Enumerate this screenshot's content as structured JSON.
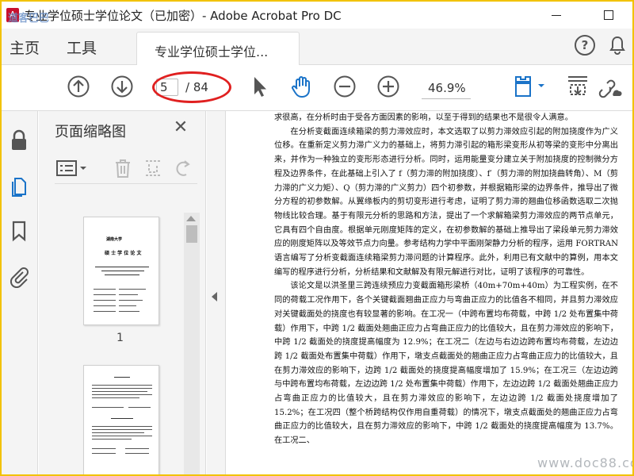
{
  "window": {
    "title": "专业学位硕士学位论文（已加密）- Adobe Acrobat Pro DC"
  },
  "tabs": {
    "home": "主页",
    "tools": "工具",
    "document": "专业学位硕士学位..."
  },
  "toolbar": {
    "page_current": "5",
    "page_total": "/ 84",
    "zoom": "46.9%",
    "icons": [
      "prev-page-icon",
      "next-page-icon",
      "select-arrow-icon",
      "hand-icon",
      "zoom-out-icon",
      "zoom-in-icon",
      "page-layout-icon",
      "scroll-mode-icon",
      "link-icon"
    ]
  },
  "sidebar": {
    "panel_title": "页面缩略图",
    "thumbnails": [
      {
        "label": "1",
        "university": "湖南大学",
        "heading": "硕 士 学 位 论 文"
      },
      {
        "label": ""
      }
    ]
  },
  "document": {
    "paragraphs": [
      {
        "indent": false,
        "text": "求很高，在分析时由于受各方面因素的影响，以至于得到的结果也不是很令人满意。"
      },
      {
        "indent": true,
        "text": "在分析变截面连续箱梁的剪力滞效应时，本文选取了以剪力滞效应引起的附加挠度作为广义位移。在重新定义剪力滞广义力的基础上，将剪力滞引起的箱形梁变形从初等梁的变形中分离出来，并作为一种独立的变形形态进行分析。同时，运用能量变分建立关于附加挠度的控制微分方程及边界条件，在此基础上引入了 f（剪力滞的附加挠度）、f′（剪力滞的附加挠曲转角）、M（剪力滞的广义力矩）、Q（剪力滞的广义剪力）四个初参数，并根据箱形梁的边界条件，推导出了微分方程的初参数解。从翼缘板内的剪切变形进行考虑，证明了剪力滞的翘曲位移函数选取二次抛物线比较合理。基于有限元分析的思路和方法，提出了一个求解箱梁剪力滞效应的两节点单元，它具有四个自由度。根据单元刚度矩阵的定义，在初参数解的基础上推导出了梁段单元剪力滞效应的刚度矩阵以及等效节点力向量。参考结构力学中平面刚架静力分析的程序，运用 FORTRAN 语言编写了分析变截面连续箱梁剪力滞问题的计算程序。此外，利用已有文献中的算例，用本文编写的程序进行分析，分析结果和文献解及有限元解进行对比，证明了该程序的可靠性。"
      },
      {
        "indent": true,
        "text": "该论文是以洪圣里三跨连续预应力变截面箱形梁桥（40m+70m+40m）为工程实例，在不同的荷载工况作用下，各个关键截面翘曲正应力与弯曲正应力的比值各不相同，并且剪力滞效应对关键截面处的挠度也有较显著的影响。在工况一（中跨布置均布荷载，中跨 1/2 处布置集中荷载）作用下，中跨 1/2 截面处翘曲正应力占弯曲正应力的比值较大，且在剪力滞效应的影响下，中跨 1/2 截面处的挠度提高幅度为 12.9%；在工况二（左边与右边边跨布置均布荷载，左边边跨 1/2 截面处布置集中荷载）作用下，墩支点截面处的翘曲正应力占弯曲正应力的比值较大，且在剪力滞效应的影响下，边跨 1/2 截面处的挠度提高幅度增加了 15.9%；在工况三（左边边跨与中跨布置均布荷载，左边边跨 1/2 处布置集中荷载）作用下，左边边跨 1/2 截面处翘曲正应力占弯曲正应力的比值较大，且在剪力滞效应的影响下，左边边跨 1/2 截面处挠度增加了 15.2%；在工况四（整个桥跨结构仅作用自重荷载）的情况下，墩支点截面处的翘曲正应力占弯曲正应力的比值较大，且在剪力滞效应的影响下，中跨 1/2 截面处的挠度提高幅度为 13.7%。在工况二、"
      }
    ]
  },
  "watermarks": {
    "top_left": "道客巴巴",
    "bottom_right": "www.doc88.com"
  },
  "colors": {
    "annotation_red": "#e02020",
    "outer_border": "#f2c200",
    "acrobat_red": "#c8102e"
  }
}
